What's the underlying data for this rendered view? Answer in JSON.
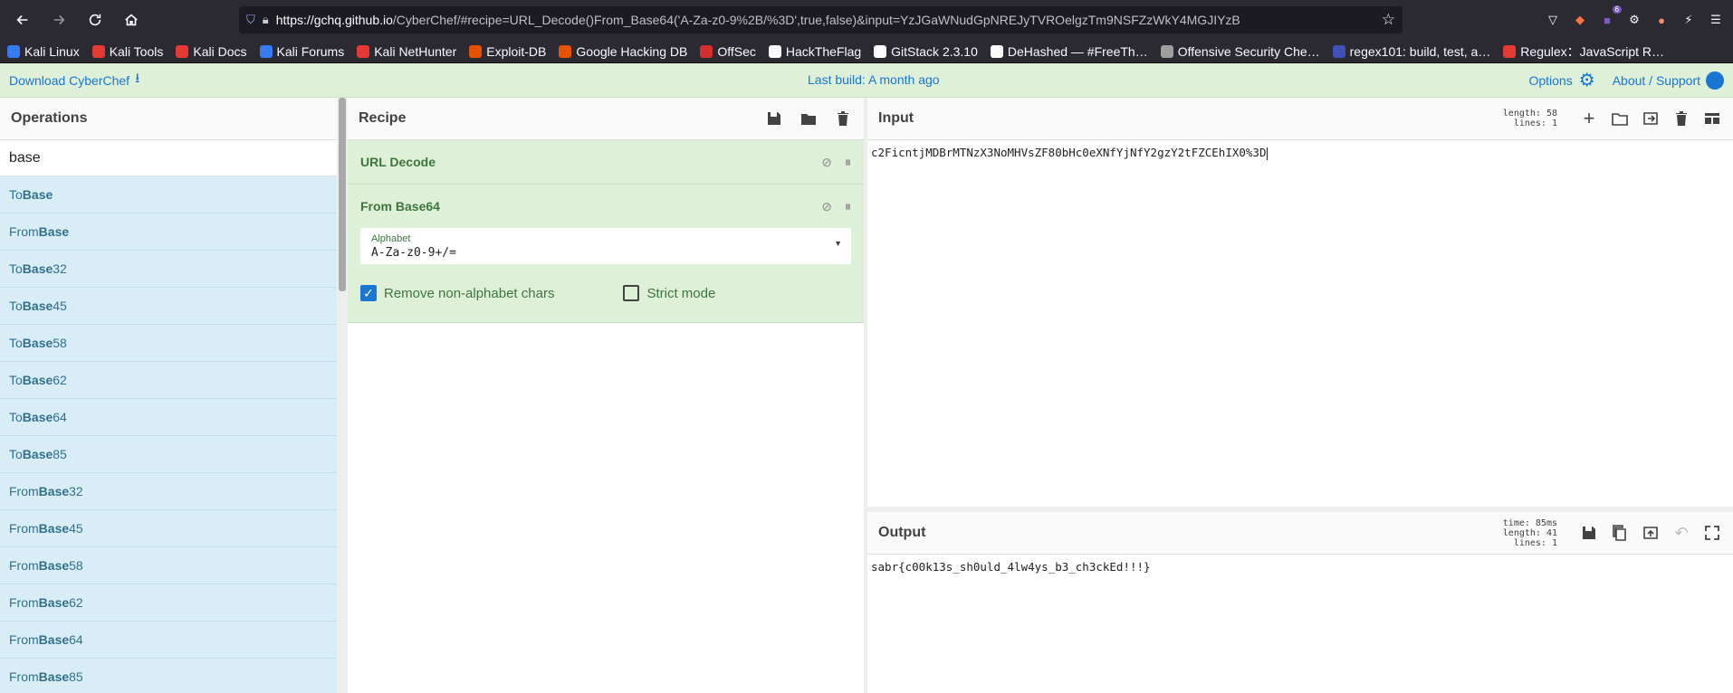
{
  "browser": {
    "url_host": "https://gchq.github.io",
    "url_rest": "/CyberChef/#recipe=URL_Decode()From_Base64('A-Za-z0-9%2B/%3D',true,false)&input=YzJGaWNudGpNREJyTVROelgzTm9NSFZzWkY4MGJIYzB",
    "extension_badge": "6"
  },
  "bookmarks": [
    {
      "label": "Kali Linux",
      "icon": "kali-icon",
      "color": "#367bf0"
    },
    {
      "label": "Kali Tools",
      "icon": "kali-tools-icon",
      "color": "#e53935"
    },
    {
      "label": "Kali Docs",
      "icon": "kali-docs-icon",
      "color": "#e53935"
    },
    {
      "label": "Kali Forums",
      "icon": "kali-forums-icon",
      "color": "#367bf0"
    },
    {
      "label": "Kali NetHunter",
      "icon": "nethunter-icon",
      "color": "#e53935"
    },
    {
      "label": "Exploit-DB",
      "icon": "exploitdb-icon",
      "color": "#e65100"
    },
    {
      "label": "Google Hacking DB",
      "icon": "ghdb-icon",
      "color": "#e65100"
    },
    {
      "label": "OffSec",
      "icon": "offsec-icon",
      "color": "#d32f2f"
    },
    {
      "label": "HackTheFlag",
      "icon": "flag-icon",
      "color": "#fbfbfe"
    },
    {
      "label": "GitStack 2.3.10",
      "icon": "globe-icon",
      "color": "#fbfbfe"
    },
    {
      "label": "DeHashed — #FreeTh…",
      "icon": "hash-icon",
      "color": "#fbfbfe"
    },
    {
      "label": "Offensive Security Che…",
      "icon": "globe-icon",
      "color": "#9e9e9e"
    },
    {
      "label": "regex101: build, test, a…",
      "icon": "regex101-icon",
      "color": "#3f51b5"
    },
    {
      "label": "Regulex：JavaScript R…",
      "icon": "regulex-icon",
      "color": "#e53935"
    }
  ],
  "banner": {
    "download": "Download CyberChef",
    "last_build": "Last build: A month ago",
    "options": "Options",
    "about": "About / Support"
  },
  "operations": {
    "title": "Operations",
    "search_value": "base",
    "items": [
      {
        "pre": "To ",
        "hl": "Base",
        "post": ""
      },
      {
        "pre": "From ",
        "hl": "Base",
        "post": ""
      },
      {
        "pre": "To ",
        "hl": "Base",
        "post": "32"
      },
      {
        "pre": "To ",
        "hl": "Base",
        "post": "45"
      },
      {
        "pre": "To ",
        "hl": "Base",
        "post": "58"
      },
      {
        "pre": "To ",
        "hl": "Base",
        "post": "62"
      },
      {
        "pre": "To ",
        "hl": "Base",
        "post": "64"
      },
      {
        "pre": "To ",
        "hl": "Base",
        "post": "85"
      },
      {
        "pre": "From ",
        "hl": "Base",
        "post": "32"
      },
      {
        "pre": "From ",
        "hl": "Base",
        "post": "45"
      },
      {
        "pre": "From ",
        "hl": "Base",
        "post": "58"
      },
      {
        "pre": "From ",
        "hl": "Base",
        "post": "62"
      },
      {
        "pre": "From ",
        "hl": "Base",
        "post": "64"
      },
      {
        "pre": "From ",
        "hl": "Base",
        "post": "85"
      }
    ]
  },
  "recipe": {
    "title": "Recipe",
    "ops": [
      {
        "name": "URL Decode"
      },
      {
        "name": "From Base64",
        "alphabet_label": "Alphabet",
        "alphabet_value": "A-Za-z0-9+/=",
        "remove_label": "Remove non-alphabet chars",
        "remove_checked": true,
        "strict_label": "Strict mode",
        "strict_checked": false
      }
    ]
  },
  "input": {
    "title": "Input",
    "length_label": "length: 58",
    "lines_label": "lines:  1",
    "text": "c2FicntjMDBrMTNzX3NoMHVsZF80bHc0eXNfYjNfY2gzY2tFZCEhIX0%3D"
  },
  "output": {
    "title": "Output",
    "time_label": "time: 85ms",
    "length_label": "length:  41",
    "lines_label": "lines:  1",
    "text": "sabr{c00k13s_sh0uld_4lw4ys_b3_ch3ckEd!!!}"
  }
}
